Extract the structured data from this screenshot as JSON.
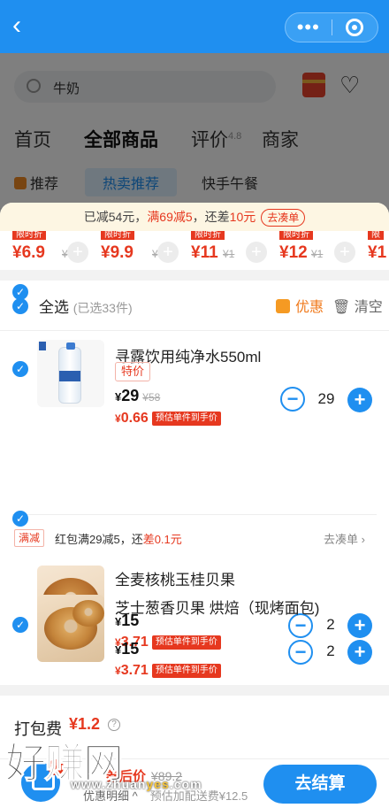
{
  "header": {
    "back_icon": "chevron-left-icon",
    "more_icon": "more-dots-icon",
    "close_icon": "target-circle-icon"
  },
  "store": {
    "search_value": "牛奶",
    "tabs": [
      {
        "label": "首页"
      },
      {
        "label": "全部商品"
      },
      {
        "label": "评价",
        "rating": "4.8"
      },
      {
        "label": "商家"
      }
    ],
    "subtabs": {
      "recommend": "推荐",
      "hot": "热卖推荐",
      "lunch": "快手午餐"
    }
  },
  "promo_bar": {
    "part1": "已减54元，",
    "part2": "满69减5",
    "part3": "，还差",
    "part4": "10元",
    "link": "去凑单"
  },
  "strip": [
    {
      "price": "¥6.9",
      "old": "¥5"
    },
    {
      "price": "¥9.9",
      "old": "¥1"
    },
    {
      "price": "¥11",
      "old": "¥1"
    },
    {
      "price": "¥12",
      "old": "¥1"
    },
    {
      "price": "¥1",
      "old": ""
    }
  ],
  "cart": {
    "select_all": "全选",
    "selected_count": "(已选33件)",
    "discount": "优惠",
    "clear": "清空",
    "items": [
      {
        "name": "寻露饮用纯净水550ml",
        "tag": "特价",
        "price": "29",
        "old_price": "¥58",
        "unit_price": "0.66",
        "unit_label": "预估单件到手价",
        "qty": "29"
      },
      {
        "name": "全麦核桃玉桂贝果",
        "price": "15",
        "unit_price": "3.71",
        "unit_label": "预估单件到手价",
        "qty": "2"
      },
      {
        "name": "芝士葱香贝果 烘焙（现烤面包)",
        "price": "15",
        "unit_price": "3.71",
        "unit_label": "预估单件到手价",
        "qty": "2"
      }
    ],
    "mj": {
      "tag": "满减",
      "text1": "红包满29减5，还",
      "text2": "差0.1元",
      "link": "去凑单 ›"
    }
  },
  "packaging": {
    "label": "打包费",
    "value": "¥1.2"
  },
  "bottom": {
    "badge": "33",
    "after_price": "券后价",
    "old_price": "¥89.2",
    "detail": "优惠明细 ^",
    "shipping": "预估加配送费¥12.5",
    "checkout": "去结算"
  },
  "watermark": {
    "text": "好赚网",
    "url_pre": "www.zhuan",
    "url_mid": "yes",
    "url_post": ".com"
  },
  "colors": {
    "accent": "#1f8ff0",
    "price_red": "#e6381f"
  }
}
